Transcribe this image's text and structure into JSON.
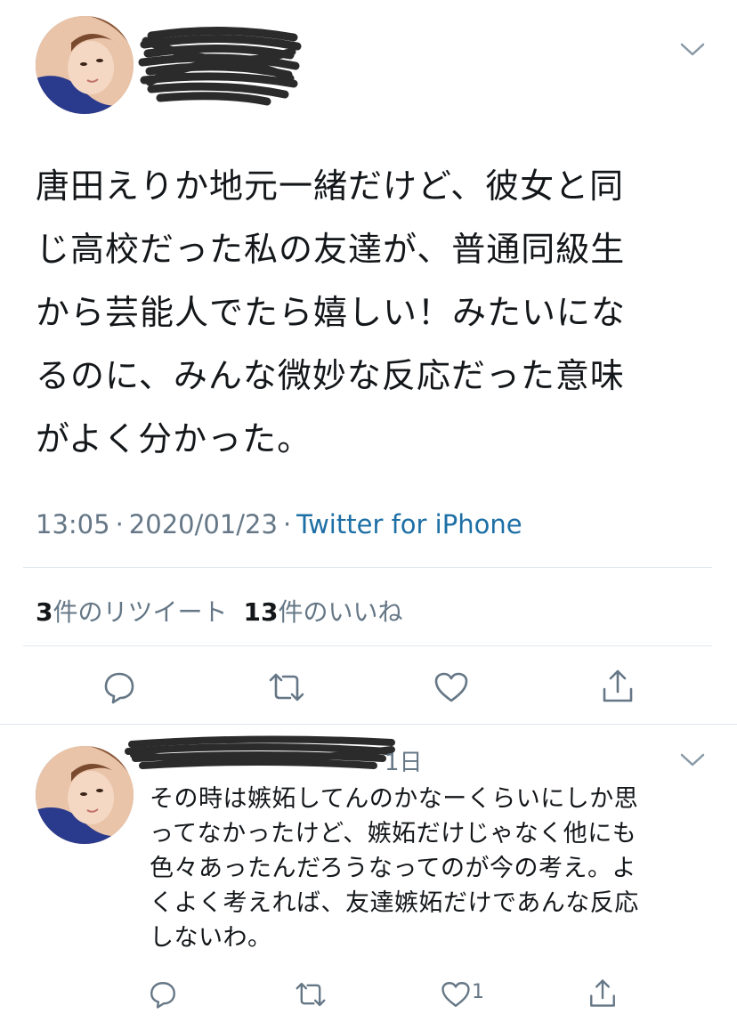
{
  "tweet": {
    "text_lines": [
      "唐田えりか地元一緒だけど、彼女と同",
      "じ高校だった私の友達が、普通同級生",
      "から芸能人でたら嬉しい！みたいにな",
      "るのに、みんな微妙な反応だった意味",
      "がよく分かった。"
    ],
    "time": "13:05",
    "date": "2020/01/23",
    "separator": "·",
    "source": "Twitter for iPhone",
    "retweet_count": "3",
    "retweet_label": "件のリツイート",
    "like_count": "13",
    "like_label": "件のいいね"
  },
  "reply": {
    "date_fragment": "1日",
    "text_lines": [
      "その時は嫉妬してんのかなーくらいにしか思",
      "ってなかったけど、嫉妬だけじゃなく他にも",
      "色々あったんだろうなってのが今の考え。よ",
      "くよく考えれば、友達嫉妬だけであんな反応",
      "しないわ。"
    ],
    "like_count": "1"
  },
  "icons": {
    "menu": "chevron-down-icon",
    "reply": "reply-bubble-icon",
    "retweet": "retweet-icon",
    "like": "heart-icon",
    "share": "share-icon"
  },
  "colors": {
    "text": "#14171a",
    "secondary": "#657786",
    "link": "#1d6fa5",
    "divider": "#e1e8ed"
  }
}
